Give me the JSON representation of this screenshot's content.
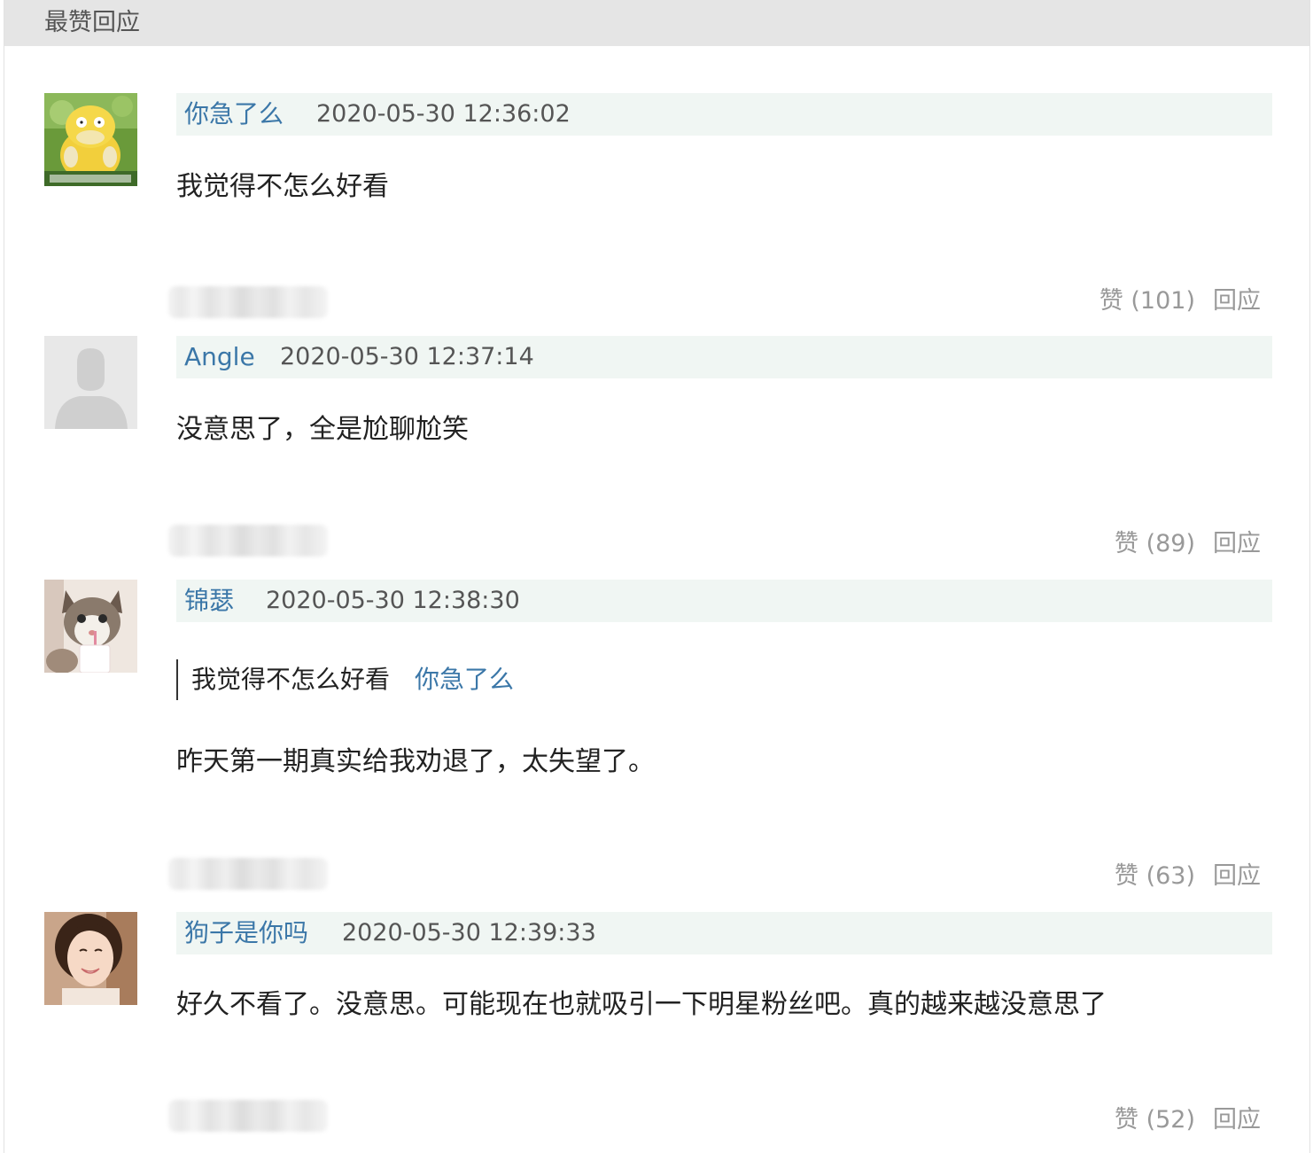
{
  "section": {
    "title": "最赞回应"
  },
  "comments": [
    {
      "username": "你急了么",
      "timestamp": "2020-05-30 12:36:02",
      "body": "我觉得不怎么好看",
      "like_label": "赞 (101)",
      "reply_label": "回应",
      "avatar_icon": "psyduck-avatar"
    },
    {
      "username": "Angle",
      "timestamp": "2020-05-30 12:37:14",
      "body": "没意思了，全是尬聊尬笑",
      "like_label": "赞 (89)",
      "reply_label": "回应",
      "avatar_icon": "default-user-avatar"
    },
    {
      "username": "锦瑟",
      "timestamp": "2020-05-30 12:38:30",
      "quote": {
        "text": "我觉得不怎么好看",
        "author": "你急了么"
      },
      "body": "昨天第一期真实给我劝退了，太失望了。",
      "like_label": "赞 (63)",
      "reply_label": "回应",
      "avatar_icon": "cat-avatar"
    },
    {
      "username": "狗子是你吗",
      "timestamp": "2020-05-30 12:39:33",
      "body": "好久不看了。没意思。可能现在也就吸引一下明星粉丝吧。真的越来越没意思了",
      "like_label": "赞 (52)",
      "reply_label": "回应",
      "avatar_icon": "woman-photo-avatar"
    }
  ],
  "colors": {
    "header_bg": "#e5e5e5",
    "meta_bar_bg": "#f0f6f3",
    "link": "#3b77a8",
    "muted": "#999999"
  }
}
